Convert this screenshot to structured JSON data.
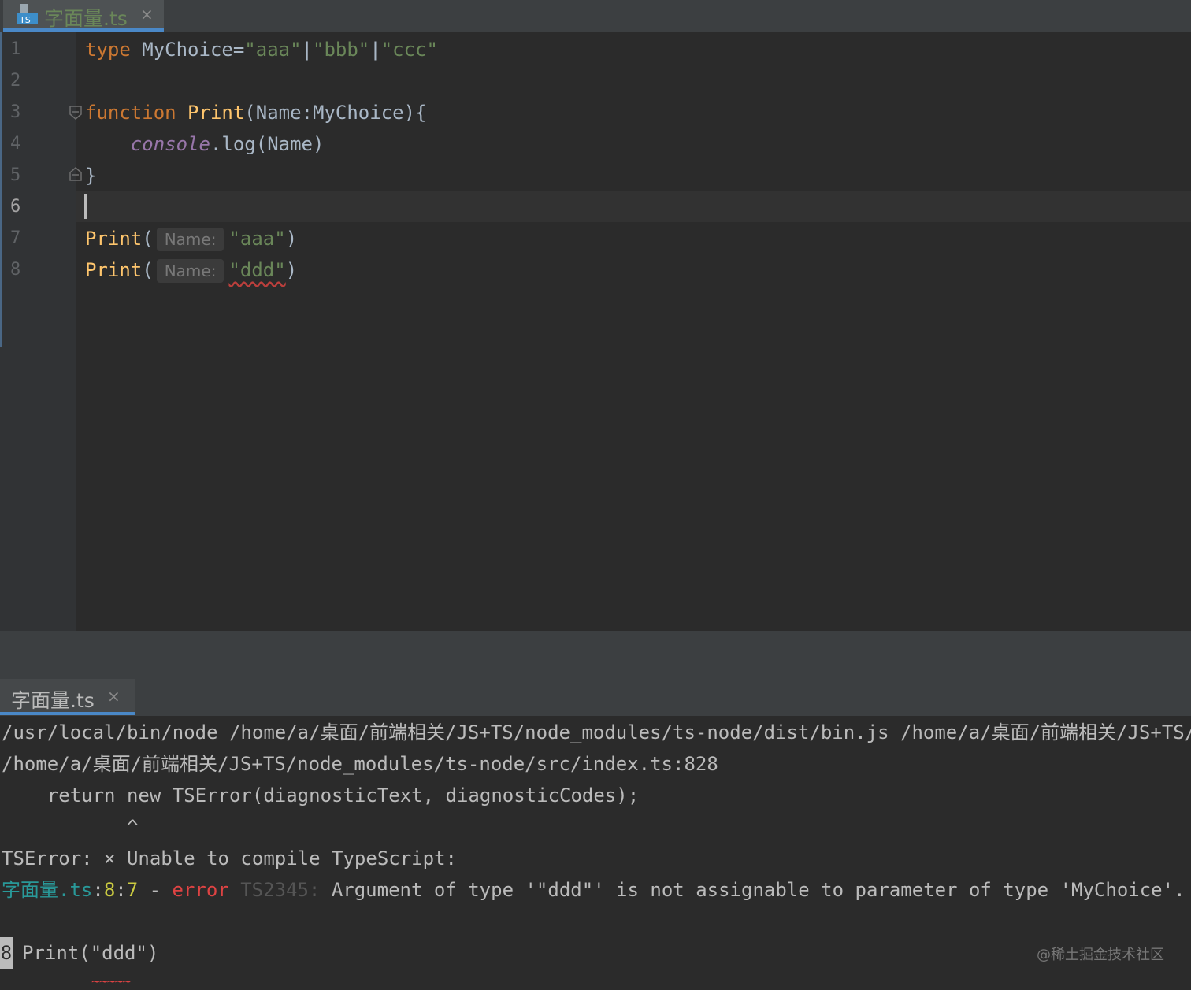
{
  "editor_tab": {
    "label": "字面量.ts",
    "close": "×",
    "icon_text": "TS"
  },
  "line_numbers": [
    "1",
    "2",
    "3",
    "4",
    "5",
    "6",
    "7",
    "8"
  ],
  "code": {
    "l1": {
      "kw": "type",
      "rest_a": " MyChoice=",
      "s1": "\"aaa\"",
      "p1": "|",
      "s2": "\"bbb\"",
      "p2": "|",
      "s3": "\"ccc\""
    },
    "l3": {
      "kw": "function",
      "sp": " ",
      "fn": "Print",
      "rest": "(Name:MyChoice){"
    },
    "l4": {
      "indent": "    ",
      "obj": "console",
      "rest": ".log(Name)"
    },
    "l5": {
      "brace": "}"
    },
    "l7": {
      "fn": "Print",
      "open": "(",
      "hint": "Name:",
      "str": "\"aaa\"",
      "close": ")"
    },
    "l8": {
      "fn": "Print",
      "open": "(",
      "hint": "Name:",
      "str": "\"ddd\"",
      "close": ")"
    }
  },
  "run_tab": {
    "label": "字面量.ts",
    "close": "×"
  },
  "console": {
    "line1": "/usr/local/bin/node /home/a/桌面/前端相关/JS+TS/node_modules/ts-node/dist/bin.js /home/a/桌面/前端相关/JS+TS/",
    "line2": "/home/a/桌面/前端相关/JS+TS/node_modules/ts-node/src/index.ts:828",
    "line3": "    return new TSError(diagnosticText, diagnosticCodes);",
    "line4": "           ^",
    "line5": "TSError: × Unable to compile TypeScript:",
    "err": {
      "file": "字面量.ts",
      "colon1": ":",
      "line": "8",
      "colon2": ":",
      "col": "7",
      "dash": " - ",
      "word": "error",
      "code": " TS2345: ",
      "msg": "Argument of type '\"ddd\"' is not assignable to parameter of type 'MyChoice'."
    },
    "src_linenum": "8",
    "src_line": "Print(\"ddd\")",
    "tilde": "~~~~~"
  },
  "watermark": "@稀土掘金技术社区",
  "colors": {
    "keyword": "#cc7832",
    "function": "#ffc66d",
    "string": "#6a8759",
    "error": "#de4343",
    "accent": "#4a88c7"
  }
}
